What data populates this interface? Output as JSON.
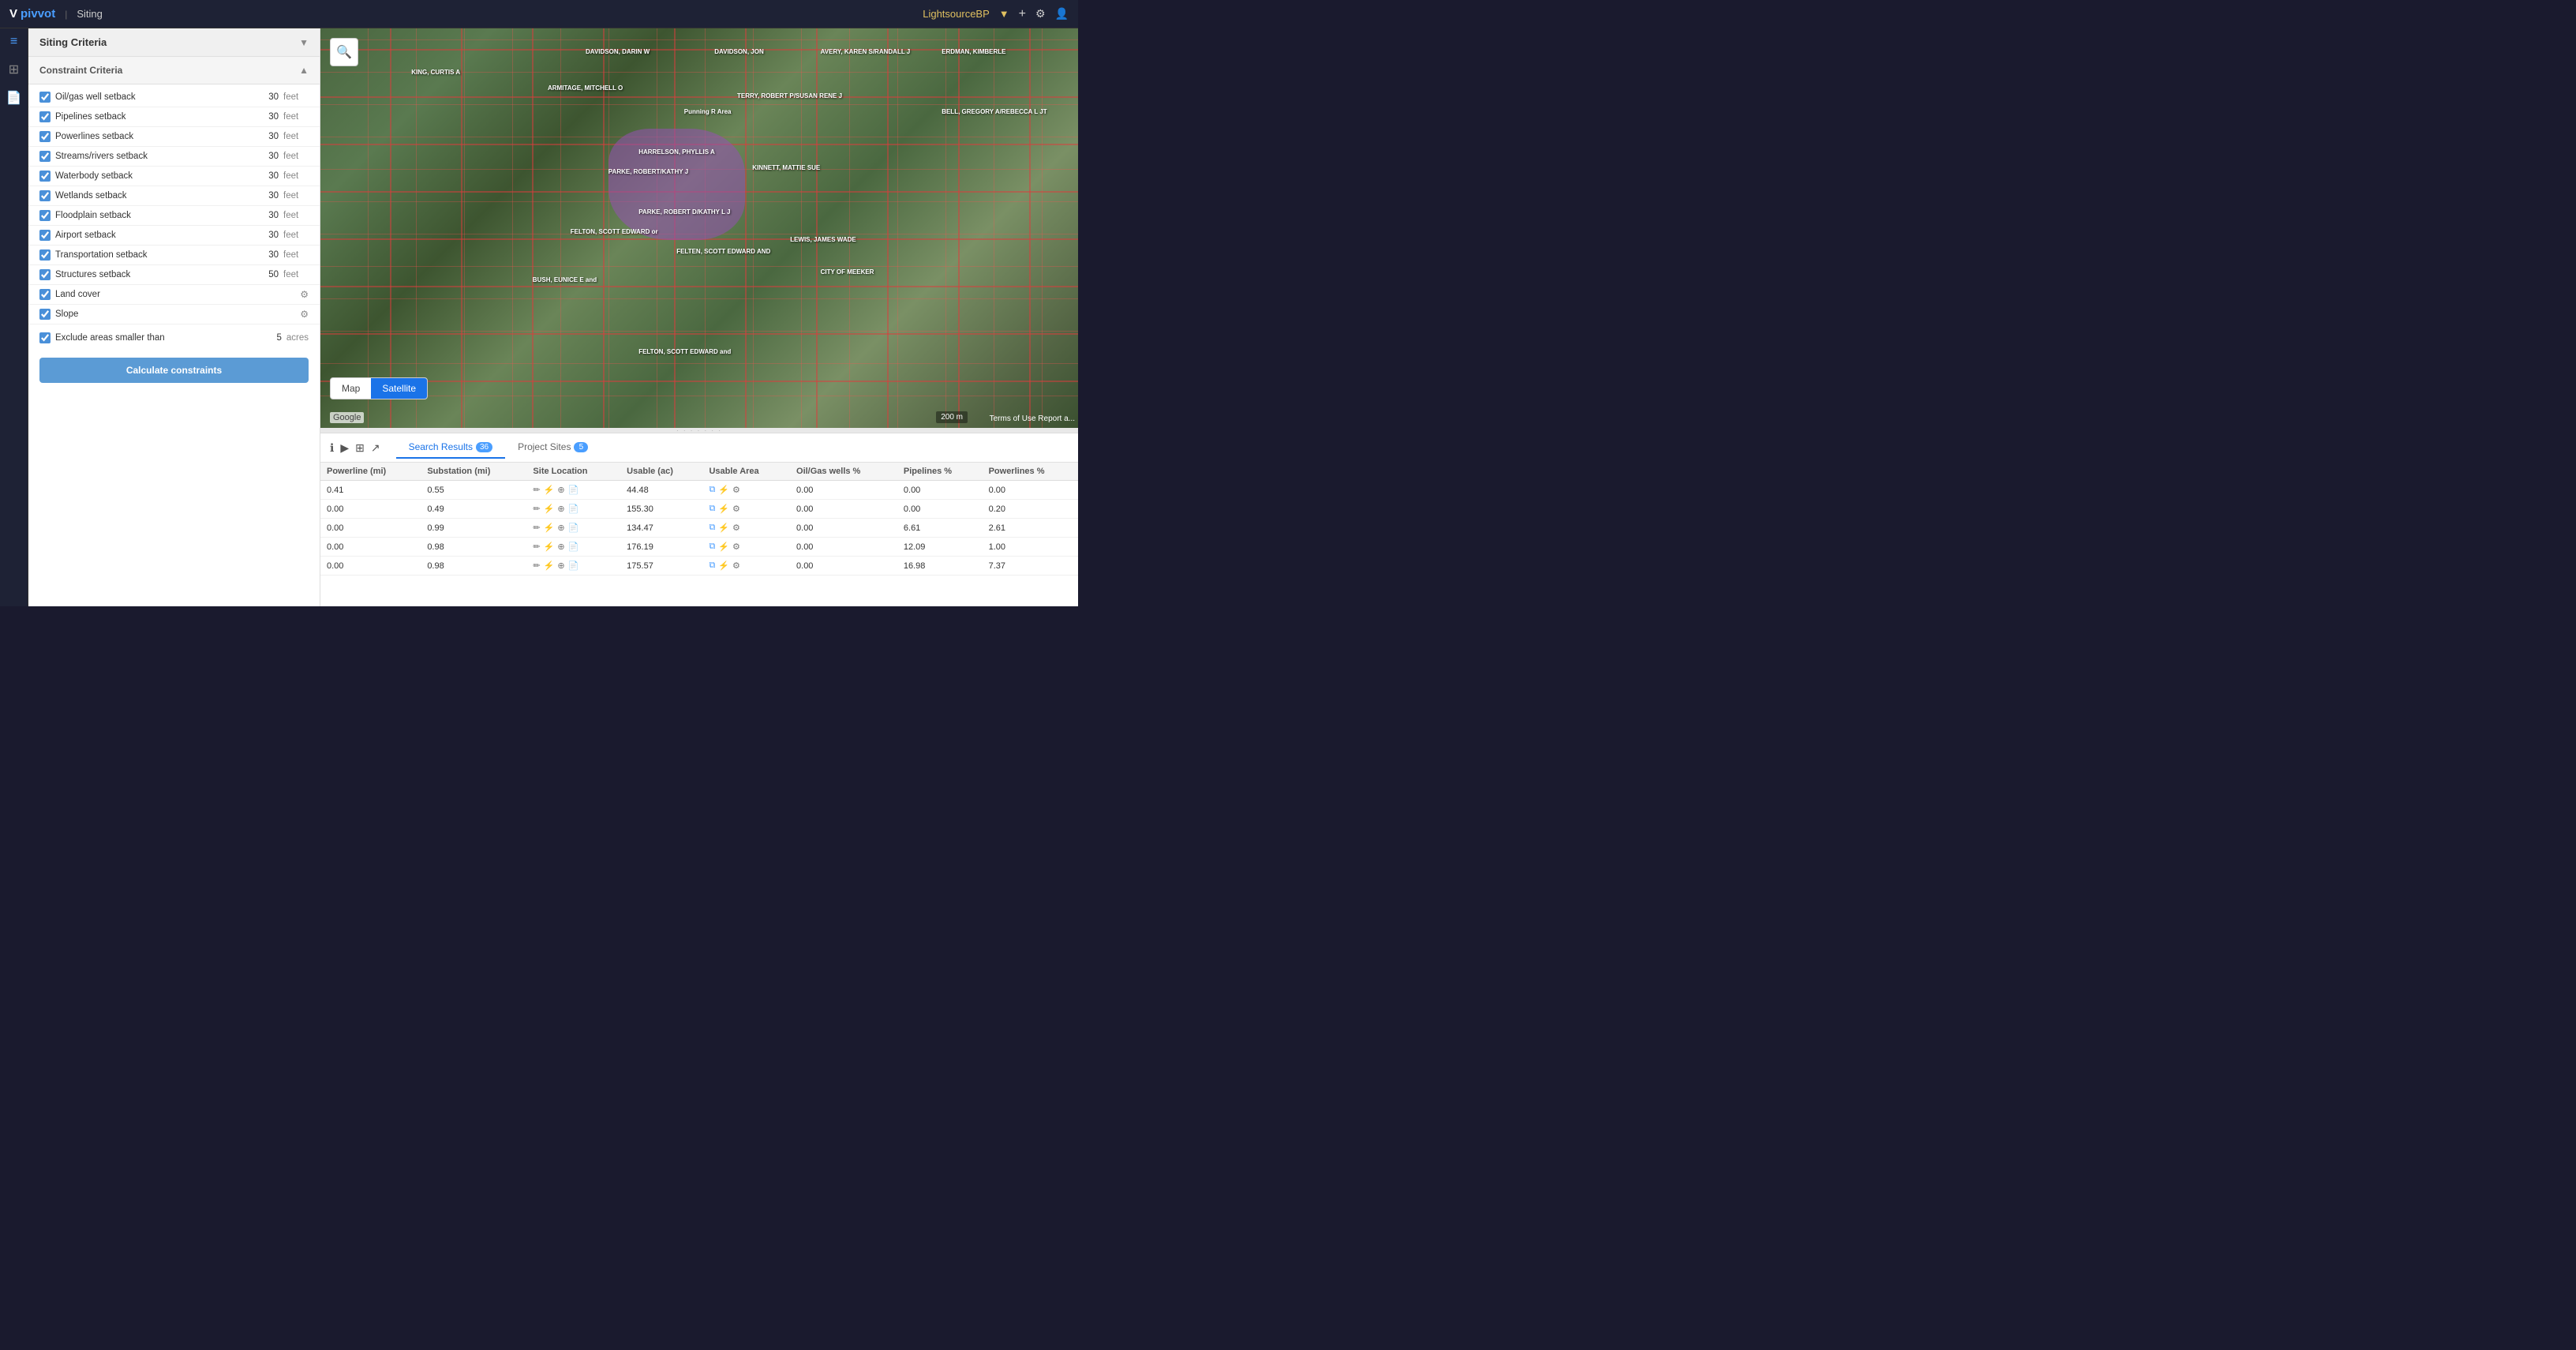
{
  "app": {
    "logo_v": "V",
    "logo_name": "pivvot",
    "divider": "|",
    "product": "Siting",
    "user": "LightsourceBP",
    "user_chevron": "▼"
  },
  "nav_icons": [
    "+",
    "⚙",
    "👤"
  ],
  "left_icons": [
    "≡",
    "☰",
    "📄"
  ],
  "sidebar": {
    "siting_criteria_label": "Siting Criteria",
    "constraint_criteria_label": "Constraint Criteria",
    "criteria": [
      {
        "id": "oil_gas",
        "label": "Oil/gas well setback",
        "value": "30",
        "unit": "feet",
        "checked": true
      },
      {
        "id": "pipelines",
        "label": "Pipelines setback",
        "value": "30",
        "unit": "feet",
        "checked": true
      },
      {
        "id": "powerlines",
        "label": "Powerlines setback",
        "value": "30",
        "unit": "feet",
        "checked": true
      },
      {
        "id": "streams",
        "label": "Streams/rivers setback",
        "value": "30",
        "unit": "feet",
        "checked": true
      },
      {
        "id": "waterbody",
        "label": "Waterbody setback",
        "value": "30",
        "unit": "feet",
        "checked": true
      },
      {
        "id": "wetlands",
        "label": "Wetlands setback",
        "value": "30",
        "unit": "feet",
        "checked": true
      },
      {
        "id": "floodplain",
        "label": "Floodplain setback",
        "value": "30",
        "unit": "feet",
        "checked": true
      },
      {
        "id": "airport",
        "label": "Airport setback",
        "value": "30",
        "unit": "feet",
        "checked": true
      },
      {
        "id": "transportation",
        "label": "Transportation setback",
        "value": "30",
        "unit": "feet",
        "checked": true
      },
      {
        "id": "structures",
        "label": "Structures setback",
        "value": "50",
        "unit": "feet",
        "checked": true
      }
    ],
    "land_cover_label": "Land cover",
    "slope_label": "Slope",
    "exclude_label": "Exclude areas smaller than",
    "exclude_value": "5",
    "exclude_unit": "acres",
    "calc_btn": "Calculate constraints"
  },
  "map": {
    "type_map": "Map",
    "type_satellite": "Satellite",
    "active_type": "Satellite",
    "attribution": "Google",
    "scale": "200 m",
    "terms": "Terms of Use   Report a..."
  },
  "bottom_panel": {
    "tabs": [
      {
        "id": "search",
        "label": "Search Results",
        "badge": "36"
      },
      {
        "id": "sites",
        "label": "Project Sites",
        "badge": "5"
      }
    ],
    "active_tab": "search",
    "columns": [
      "Powerline (mi)",
      "Substation (mi)",
      "Site Location",
      "Usable (ac)",
      "Usable Area",
      "Oil/Gas wells %",
      "Pipelines %",
      "Powerlines %"
    ],
    "rows": [
      {
        "powerline": "0.41",
        "substation": "0.55",
        "usable_ac": "44.48",
        "oil_gas": "0.00",
        "pipelines": "0.00",
        "powerlines": "0.00"
      },
      {
        "powerline": "0.00",
        "substation": "0.49",
        "usable_ac": "155.30",
        "oil_gas": "0.00",
        "pipelines": "0.00",
        "powerlines": "0.20"
      },
      {
        "powerline": "0.00",
        "substation": "0.99",
        "usable_ac": "134.47",
        "oil_gas": "0.00",
        "pipelines": "6.61",
        "powerlines": "2.61"
      },
      {
        "powerline": "0.00",
        "substation": "0.98",
        "usable_ac": "176.19",
        "oil_gas": "0.00",
        "pipelines": "12.09",
        "powerlines": "1.00"
      },
      {
        "powerline": "0.00",
        "substation": "0.98",
        "usable_ac": "175.57",
        "oil_gas": "0.00",
        "pipelines": "16.98",
        "powerlines": "7.37"
      }
    ]
  }
}
